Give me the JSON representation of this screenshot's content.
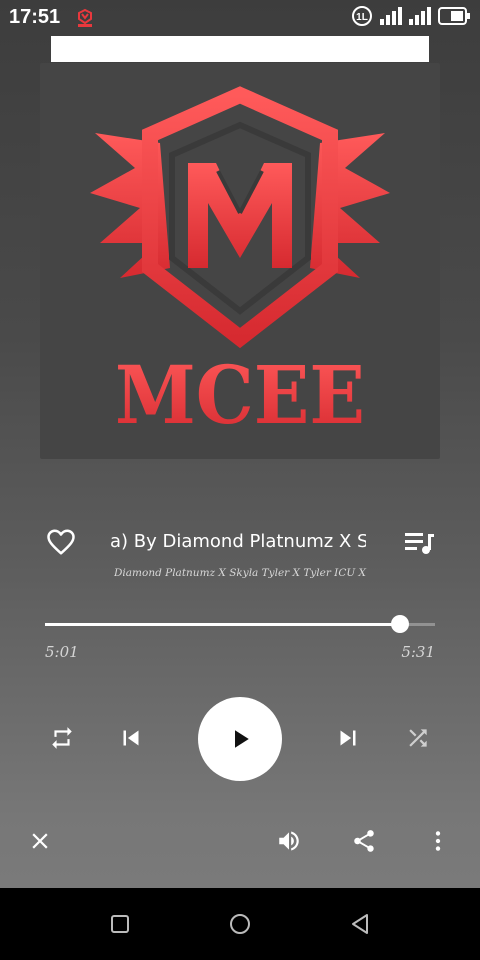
{
  "status_bar": {
    "time": "17:51",
    "notification_icon": "mcee-app-icon",
    "icons": [
      "volte-icon",
      "signal-icon",
      "signal-icon",
      "battery-icon"
    ],
    "volte_text": "1L"
  },
  "album_art": {
    "logo_text": "MCEE",
    "accent_color": "#e8383d"
  },
  "track": {
    "title": "a) By Diamond Platnumz X Skyla T",
    "artist": "Diamond Platnumz X Skyla Tyler X Tyler ICU X K...",
    "favorite_icon": "heart-outline-icon",
    "queue_icon": "playlist-icon"
  },
  "progress": {
    "current": "5:01",
    "duration": "5:31",
    "fraction": 0.909
  },
  "controls": {
    "repeat_icon": "repeat-icon",
    "previous_icon": "skip-previous-icon",
    "play_icon": "play-icon",
    "next_icon": "skip-next-icon",
    "shuffle_icon": "shuffle-icon"
  },
  "actions": {
    "close_icon": "close-icon",
    "volume_icon": "volume-icon",
    "share_icon": "share-icon",
    "more_icon": "more-vertical-icon"
  },
  "nav_bar": [
    "recents-icon",
    "home-icon",
    "back-icon"
  ]
}
